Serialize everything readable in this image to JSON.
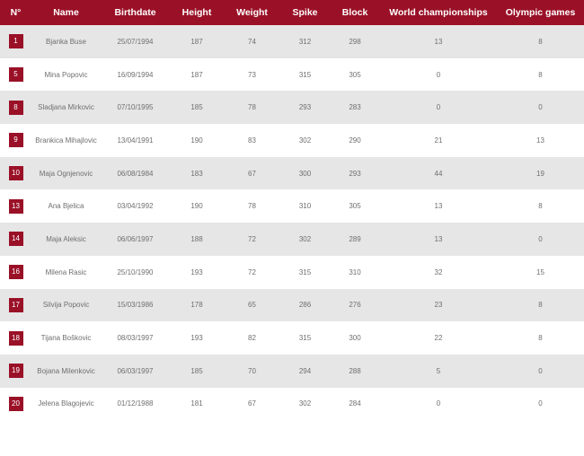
{
  "table": {
    "headers": {
      "number": "N°",
      "name": "Name",
      "birthdate": "Birthdate",
      "height": "Height",
      "weight": "Weight",
      "spike": "Spike",
      "block": "Block",
      "world_championships": "World championships",
      "olympic_games": "Olympic games"
    },
    "rows": [
      {
        "number": "1",
        "name": "Bjanka Buse",
        "birthdate": "25/07/1994",
        "height": "187",
        "weight": "74",
        "spike": "312",
        "block": "298",
        "world_championships": "13",
        "olympic_games": "8"
      },
      {
        "number": "5",
        "name": "Mina Popovic",
        "birthdate": "16/09/1994",
        "height": "187",
        "weight": "73",
        "spike": "315",
        "block": "305",
        "world_championships": "0",
        "olympic_games": "8"
      },
      {
        "number": "8",
        "name": "Sladjana Mirkovic",
        "birthdate": "07/10/1995",
        "height": "185",
        "weight": "78",
        "spike": "293",
        "block": "283",
        "world_championships": "0",
        "olympic_games": "0"
      },
      {
        "number": "9",
        "name": "Brankica Mihajlovic",
        "birthdate": "13/04/1991",
        "height": "190",
        "weight": "83",
        "spike": "302",
        "block": "290",
        "world_championships": "21",
        "olympic_games": "13"
      },
      {
        "number": "10",
        "name": "Maja Ognjenovic",
        "birthdate": "06/08/1984",
        "height": "183",
        "weight": "67",
        "spike": "300",
        "block": "293",
        "world_championships": "44",
        "olympic_games": "19"
      },
      {
        "number": "13",
        "name": "Ana Bjelica",
        "birthdate": "03/04/1992",
        "height": "190",
        "weight": "78",
        "spike": "310",
        "block": "305",
        "world_championships": "13",
        "olympic_games": "8"
      },
      {
        "number": "14",
        "name": "Maja Aleksic",
        "birthdate": "06/06/1997",
        "height": "188",
        "weight": "72",
        "spike": "302",
        "block": "289",
        "world_championships": "13",
        "olympic_games": "0"
      },
      {
        "number": "16",
        "name": "Milena Rasic",
        "birthdate": "25/10/1990",
        "height": "193",
        "weight": "72",
        "spike": "315",
        "block": "310",
        "world_championships": "32",
        "olympic_games": "15"
      },
      {
        "number": "17",
        "name": "Silvija Popovic",
        "birthdate": "15/03/1986",
        "height": "178",
        "weight": "65",
        "spike": "286",
        "block": "276",
        "world_championships": "23",
        "olympic_games": "8"
      },
      {
        "number": "18",
        "name": "Tijana Boškovic",
        "birthdate": "08/03/1997",
        "height": "193",
        "weight": "82",
        "spike": "315",
        "block": "300",
        "world_championships": "22",
        "olympic_games": "8"
      },
      {
        "number": "19",
        "name": "Bojana Milenkovic",
        "birthdate": "06/03/1997",
        "height": "185",
        "weight": "70",
        "spike": "294",
        "block": "288",
        "world_championships": "5",
        "olympic_games": "0"
      },
      {
        "number": "20",
        "name": "Jelena Blagojevic",
        "birthdate": "01/12/1988",
        "height": "181",
        "weight": "67",
        "spike": "302",
        "block": "284",
        "world_championships": "0",
        "olympic_games": "0"
      }
    ]
  },
  "colors": {
    "header_bg": "#9a1127",
    "badge_bg": "#9a1127",
    "row_alt_bg": "#e6e6e6",
    "text": "#6f6f6f"
  }
}
